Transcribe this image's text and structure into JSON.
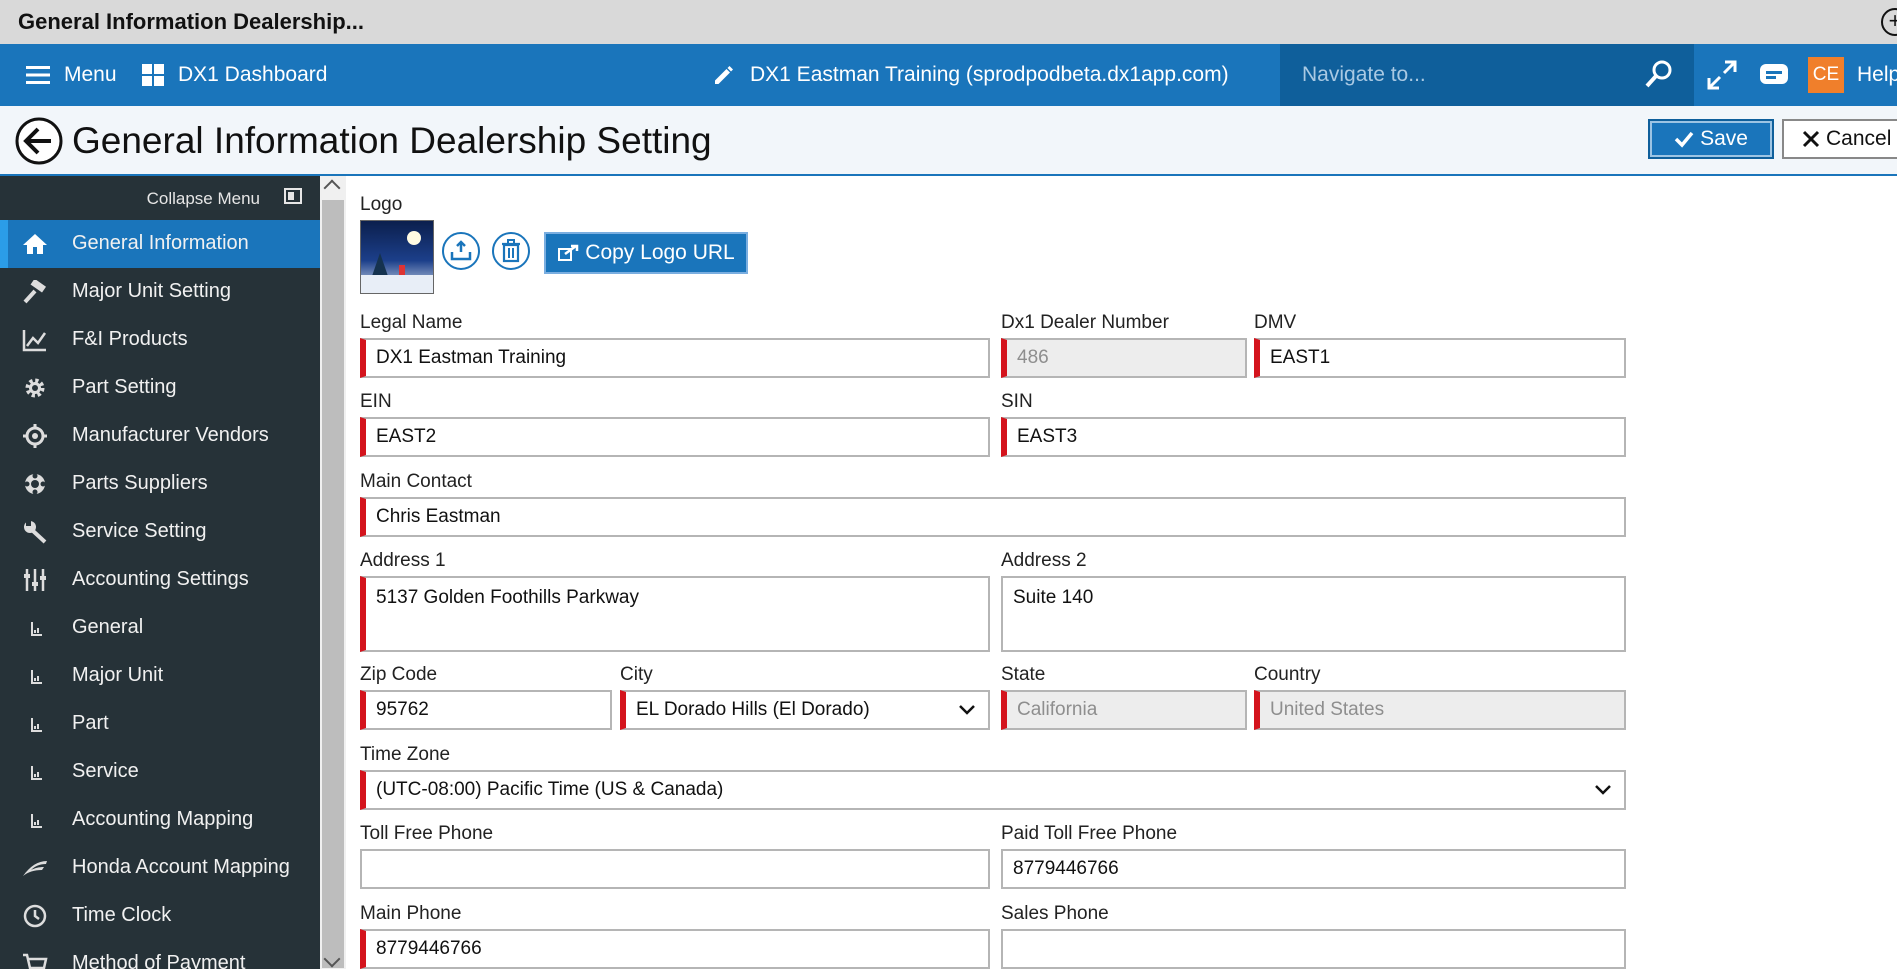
{
  "window": {
    "title": "General Information Dealership..."
  },
  "nav": {
    "menu_label": "Menu",
    "dashboard_label": "DX1 Dashboard",
    "site_label": "DX1 Eastman Training (sprodpodbeta.dx1app.com)",
    "search_placeholder": "Navigate to...",
    "avatar_initials": "CE",
    "help_label": "Help"
  },
  "page": {
    "title": "General Information Dealership Setting",
    "save_label": "Save",
    "cancel_label": "Cancel"
  },
  "sidebar": {
    "collapse_label": "Collapse Menu",
    "items": [
      {
        "label": "General Information",
        "icon": "home-icon",
        "active": true
      },
      {
        "label": "Major Unit Setting",
        "icon": "hammer-icon"
      },
      {
        "label": "F&I Products",
        "icon": "chart-icon"
      },
      {
        "label": "Part Setting",
        "icon": "gear-icon"
      },
      {
        "label": "Manufacturer Vendors",
        "icon": "crosshair-icon"
      },
      {
        "label": "Parts Suppliers",
        "icon": "lifebuoy-icon"
      },
      {
        "label": "Service Setting",
        "icon": "wrench-icon"
      },
      {
        "label": "Accounting Settings",
        "icon": "sliders-icon"
      },
      {
        "label": "General",
        "icon": "sub-chart-icon"
      },
      {
        "label": "Major Unit",
        "icon": "sub-chart-icon"
      },
      {
        "label": "Part",
        "icon": "sub-chart-icon"
      },
      {
        "label": "Service",
        "icon": "sub-chart-icon"
      },
      {
        "label": "Accounting Mapping",
        "icon": "sub-chart-icon"
      },
      {
        "label": "Honda Account Mapping",
        "icon": "honda-wing-icon"
      },
      {
        "label": "Time Clock",
        "icon": "clock-icon"
      },
      {
        "label": "Method of Payment",
        "icon": "cart-icon"
      }
    ]
  },
  "form": {
    "logo_label": "Logo",
    "copy_logo_label": "Copy Logo URL",
    "legal_name": {
      "label": "Legal Name",
      "value": "DX1 Eastman Training"
    },
    "dealer_number": {
      "label": "Dx1 Dealer Number",
      "value": "486"
    },
    "dmv": {
      "label": "DMV",
      "value": "EAST1"
    },
    "ein": {
      "label": "EIN",
      "value": "EAST2"
    },
    "sin": {
      "label": "SIN",
      "value": "EAST3"
    },
    "main_contact": {
      "label": "Main Contact",
      "value": "Chris Eastman"
    },
    "address1": {
      "label": "Address 1",
      "value": "5137 Golden Foothills Parkway"
    },
    "address2": {
      "label": "Address 2",
      "value": "Suite 140"
    },
    "zip": {
      "label": "Zip Code",
      "value": "95762"
    },
    "city": {
      "label": "City",
      "value": "EL Dorado Hills (El Dorado)"
    },
    "state": {
      "label": "State",
      "value": "California"
    },
    "country": {
      "label": "Country",
      "value": "United States"
    },
    "timezone": {
      "label": "Time Zone",
      "value": "(UTC-08:00) Pacific Time (US & Canada)"
    },
    "toll_free": {
      "label": "Toll Free Phone",
      "value": ""
    },
    "paid_toll_free": {
      "label": "Paid Toll Free Phone",
      "value": "8779446766"
    },
    "main_phone": {
      "label": "Main Phone",
      "value": "8779446766"
    },
    "sales_phone": {
      "label": "Sales Phone",
      "value": ""
    }
  },
  "colors": {
    "brand_blue": "#1a75bb",
    "sidebar_bg": "#263238",
    "required_marker": "#d4141d",
    "avatar_orange": "#f07f2b"
  }
}
